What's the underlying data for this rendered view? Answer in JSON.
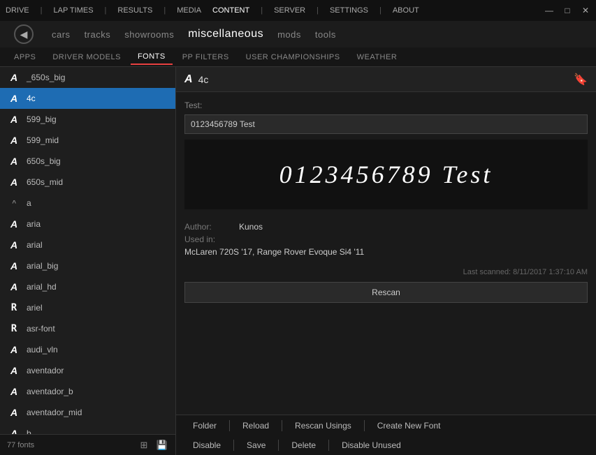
{
  "titlebar": {
    "menu_items": [
      "DRIVE",
      "|",
      "LAP TIMES",
      "|",
      "RESULTS",
      "|",
      "MEDIA",
      "CONTENT",
      "|",
      "SERVER",
      "|",
      "SETTINGS",
      "|",
      "ABOUT"
    ],
    "minimize": "—",
    "maximize": "□",
    "close": "✕"
  },
  "navbar": {
    "back_icon": "◀",
    "items": [
      {
        "label": "cars",
        "active": false
      },
      {
        "label": "tracks",
        "active": false
      },
      {
        "label": "showrooms",
        "active": false
      },
      {
        "label": "miscellaneous",
        "active": true
      },
      {
        "label": "mods",
        "active": false
      },
      {
        "label": "tools",
        "active": false
      }
    ]
  },
  "tabs": [
    {
      "label": "APPS",
      "active": false
    },
    {
      "label": "DRIVER MODELS",
      "active": false
    },
    {
      "label": "FONTS",
      "active": true
    },
    {
      "label": "PP FILTERS",
      "active": false
    },
    {
      "label": "USER CHAMPIONSHIPS",
      "active": false
    },
    {
      "label": "WEATHER",
      "active": false
    }
  ],
  "font_list": [
    {
      "name": "_650s_big",
      "icon": "A",
      "big": true
    },
    {
      "name": "4c",
      "icon": "A",
      "big": true,
      "selected": true
    },
    {
      "name": "599_big",
      "icon": "A",
      "big": true
    },
    {
      "name": "599_mid",
      "icon": "A",
      "big": true
    },
    {
      "name": "650s_big",
      "icon": "A",
      "big": true
    },
    {
      "name": "650s_mid",
      "icon": "A",
      "big": true
    },
    {
      "name": "a",
      "icon": "^",
      "small": true
    },
    {
      "name": "aria",
      "icon": "A",
      "big": true
    },
    {
      "name": "arial",
      "icon": "A",
      "big": true
    },
    {
      "name": "arial_big",
      "icon": "A",
      "big": true
    },
    {
      "name": "arial_hd",
      "icon": "A",
      "big": true
    },
    {
      "name": "ariel",
      "icon": "R",
      "big": true,
      "special": true
    },
    {
      "name": "asr-font",
      "icon": "R",
      "big": true,
      "special": true
    },
    {
      "name": "audi_vln",
      "icon": "A",
      "big": true
    },
    {
      "name": "aventador",
      "icon": "A",
      "big": true
    },
    {
      "name": "aventador_b",
      "icon": "A",
      "big": true
    },
    {
      "name": "aventador_mid",
      "icon": "A",
      "big": true
    },
    {
      "name": "b",
      "icon": "A",
      "big": true
    }
  ],
  "font_count": "77 fonts",
  "right_panel": {
    "title": "4c",
    "bookmark_icon": "🔖",
    "test_label": "Test:",
    "test_value": "0123456789 Test",
    "preview_text": "0123456789 Test",
    "author_label": "Author:",
    "author_value": "Kunos",
    "used_in_label": "Used in:",
    "used_in_value": "McLaren 720S '17, Range Rover Evoque Si4 '11",
    "scan_info": "Last scanned: 8/11/2017 1:37:10 AM",
    "rescan_label": "Rescan"
  },
  "toolbar": {
    "row1": [
      {
        "label": "Folder"
      },
      {
        "sep": true
      },
      {
        "label": "Reload"
      },
      {
        "sep": true
      },
      {
        "label": "Rescan Usings"
      },
      {
        "sep": true
      },
      {
        "label": "Create New Font"
      }
    ],
    "row2": [
      {
        "label": "Disable"
      },
      {
        "sep": true
      },
      {
        "label": "Save"
      },
      {
        "sep": true
      },
      {
        "label": "Delete"
      },
      {
        "sep": true
      },
      {
        "label": "Disable Unused"
      }
    ]
  }
}
